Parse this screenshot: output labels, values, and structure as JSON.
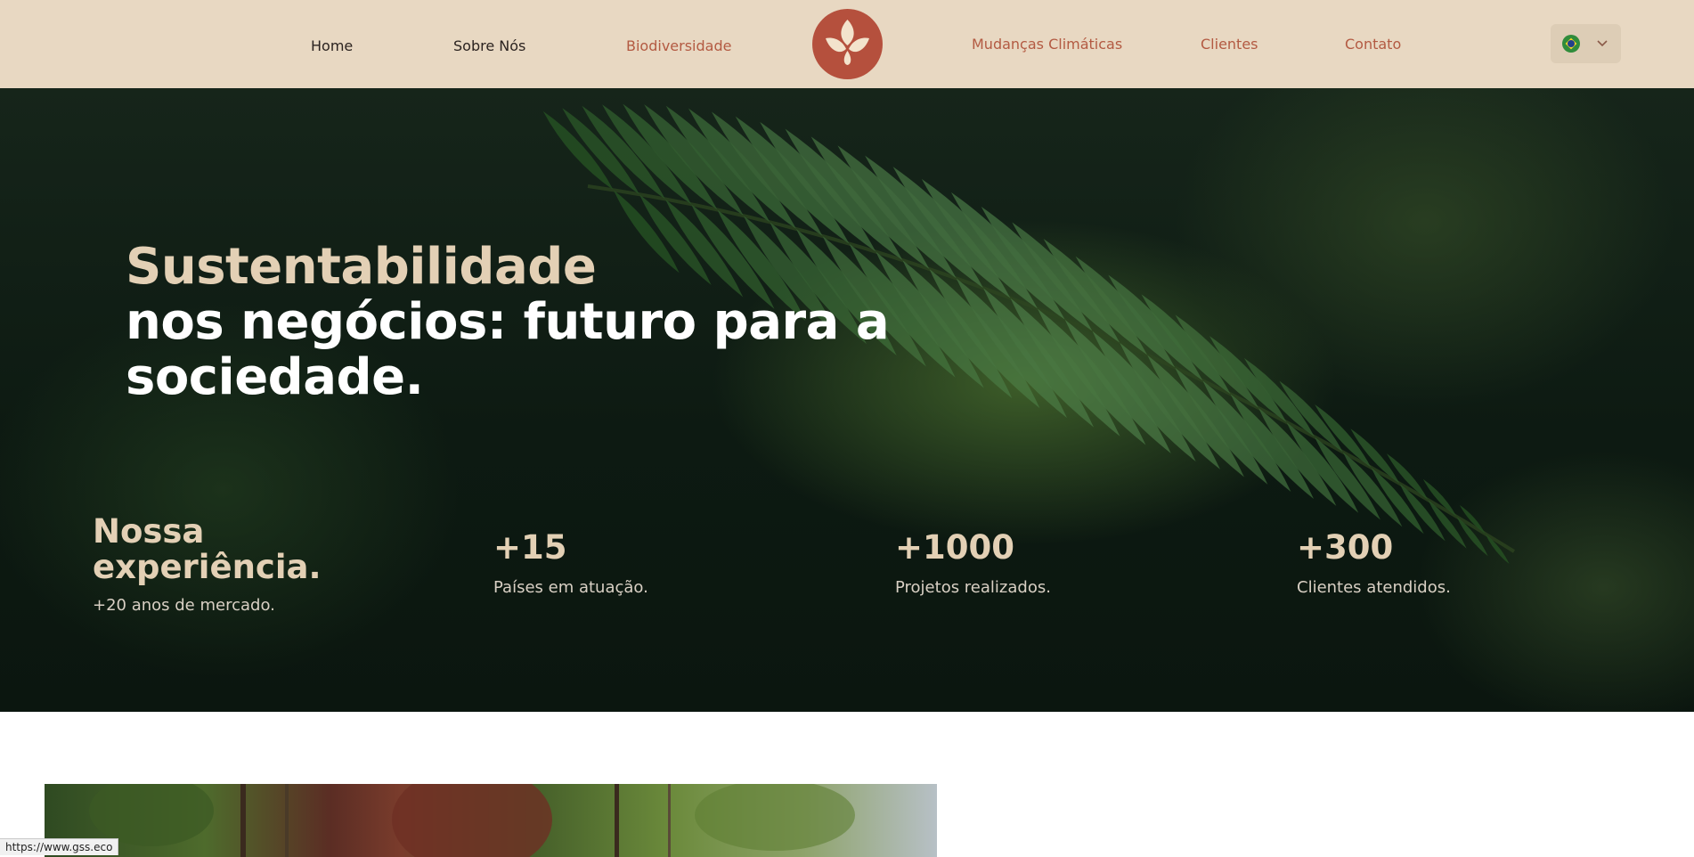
{
  "nav": {
    "home": "Home",
    "about": "Sobre Nós",
    "biodiversity": "Biodiversidade",
    "climate": "Mudanças Climáticas",
    "clients": "Clientes",
    "contact": "Contato"
  },
  "language": {
    "flag_icon": "brazil-flag-icon",
    "chevron_icon": "chevron-down-icon"
  },
  "hero": {
    "headline_line1": "Sustentabilidade",
    "headline_line2": "nos negócios: futuro para a",
    "headline_line3": "sociedade.",
    "experience_title_1": "Nossa",
    "experience_title_2": "experiência.",
    "experience_sub": "+20 anos de mercado.",
    "stats": [
      {
        "value": "+15",
        "label": "Países em atuação."
      },
      {
        "value": "+1000",
        "label": "Projetos realizados."
      },
      {
        "value": "+300",
        "label": "Clientes atendidos."
      }
    ]
  },
  "status_url": "https://www.gss.eco",
  "colors": {
    "header_bg": "#e8d8c2",
    "accent": "#b35a42",
    "hero_heading_cream": "#e3d0b5",
    "hero_bg": "#0d1a12"
  }
}
